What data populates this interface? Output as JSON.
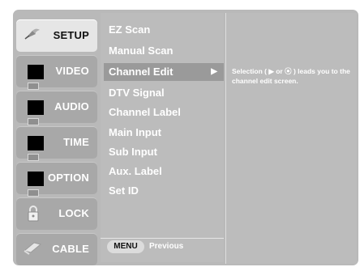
{
  "tabs": [
    {
      "label": "SETUP",
      "icon": "satellite-dish-icon",
      "active": true
    },
    {
      "label": "VIDEO",
      "icon": "video-icon",
      "active": false
    },
    {
      "label": "AUDIO",
      "icon": "audio-icon",
      "active": false
    },
    {
      "label": "TIME",
      "icon": "time-icon",
      "active": false
    },
    {
      "label": "OPTION",
      "icon": "option-icon",
      "active": false
    },
    {
      "label": "LOCK",
      "icon": "lock-icon",
      "active": false
    },
    {
      "label": "CABLE",
      "icon": "cable-icon",
      "active": false
    }
  ],
  "menu": {
    "items": [
      {
        "label": "EZ Scan"
      },
      {
        "label": "Manual Scan"
      },
      {
        "label": "Channel Edit",
        "arrow": "▶",
        "selected": true
      },
      {
        "label": "DTV Signal"
      },
      {
        "label": "Channel Label"
      },
      {
        "label": "Main Input"
      },
      {
        "label": "Sub Input"
      },
      {
        "label": "Aux. Label"
      },
      {
        "label": "Set ID"
      }
    ],
    "footer_button": "MENU",
    "footer_text": "Previous"
  },
  "help": {
    "text": "Selection ( ▶ or ⦿ ) leads you to the channel edit screen."
  }
}
